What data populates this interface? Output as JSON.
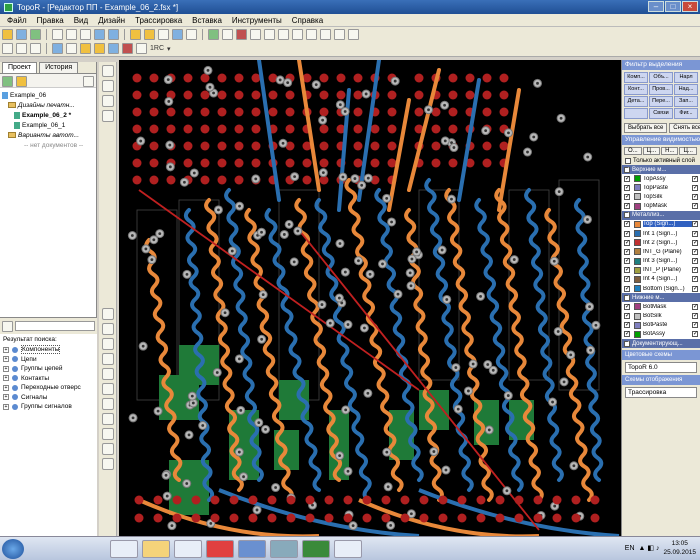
{
  "window": {
    "title": "TopoR - [Редактор ПП - Example_06_2.fsx *]"
  },
  "menu": [
    "Файл",
    "Правка",
    "Вид",
    "Дизайн",
    "Трассировка",
    "Вставка",
    "Инструменты",
    "Справка"
  ],
  "toolbar": {
    "zoom_text": "1RC"
  },
  "project": {
    "tabs": [
      "Проект",
      "История"
    ],
    "tree": [
      {
        "label": "Example_06",
        "style": "normal",
        "indent": 0,
        "icon": "doc"
      },
      {
        "label": "Дизайны печатн...",
        "style": "italic",
        "indent": 1,
        "icon": "folder"
      },
      {
        "label": "Example_06_2 *",
        "style": "bold",
        "indent": 2,
        "icon": "doc"
      },
      {
        "label": "Example_06_1",
        "style": "normal",
        "indent": 2,
        "icon": "doc"
      },
      {
        "label": "Варианты автот...",
        "style": "italic",
        "indent": 1,
        "icon": "folder"
      },
      {
        "label": "-- нет документов --",
        "style": "gray",
        "indent": 2,
        "icon": "none"
      }
    ]
  },
  "search": {
    "label": "Результат поиска:",
    "items": [
      "Компоненты",
      "Цепи",
      "Группы цепей",
      "Контакты",
      "Переходные отверс",
      "Сигналы",
      "Группы сигналов"
    ]
  },
  "right": {
    "filter_title": "Фильтр выделения",
    "filter_buttons": [
      "Комп...",
      "Объ...",
      "Нарл",
      "Конт...",
      "Пров...",
      "Над...",
      "Дета...",
      "Пере...",
      "Зап...",
      "",
      "Связи",
      "Фиг..."
    ],
    "select_all": "Выбрать все",
    "clear": "Снять все",
    "visibility_title": "Управление видимостью",
    "vis_tabs": [
      "О...",
      "Ц...",
      "Н...",
      "Ц..."
    ],
    "only_active": "Только активный слой",
    "groups": [
      {
        "name": "Верхние м...",
        "layers": [
          {
            "name": "TopAssy",
            "color": "#00a000",
            "sel": false
          },
          {
            "name": "TopPaste",
            "color": "#8080c0",
            "sel": false
          },
          {
            "name": "TopSilk",
            "color": "#c0c0c0",
            "sel": false
          },
          {
            "name": "TopMask",
            "color": "#a04080",
            "sel": false
          }
        ]
      },
      {
        "name": "Металлиз...",
        "layers": [
          {
            "name": "Top (Sign...)",
            "color": "#e8883a",
            "sel": true
          },
          {
            "name": "Int 1 (Sign...)",
            "color": "#2a6fb0",
            "sel": false
          },
          {
            "name": "Int 2 (Sign...)",
            "color": "#c03030",
            "sel": false
          },
          {
            "name": "INT_G (Plane)",
            "color": "#b08040",
            "sel": false
          },
          {
            "name": "Int 3 (Sign...)",
            "color": "#208080",
            "sel": false
          },
          {
            "name": "INT_P (Plane)",
            "color": "#a0a040",
            "sel": false
          },
          {
            "name": "Int 4 (Sign...)",
            "color": "#806040",
            "sel": false
          },
          {
            "name": "Bottom (Sign...)",
            "color": "#2080c0",
            "sel": false
          }
        ]
      },
      {
        "name": "Нижние м...",
        "layers": [
          {
            "name": "BotMask",
            "color": "#a04080",
            "sel": false
          },
          {
            "name": "BotSilk",
            "color": "#c0c0c0",
            "sel": false
          },
          {
            "name": "BotPaste",
            "color": "#8080c0",
            "sel": false
          },
          {
            "name": "BotAssy",
            "color": "#00a000",
            "sel": false
          }
        ]
      },
      {
        "name": "Документирующ...",
        "layers": []
      }
    ],
    "color_schemes_title": "Цветовые схемы",
    "color_scheme_value": "TopoR 6.0",
    "display_schemes_title": "Схемы отображения",
    "display_scheme_value": "Трассировка"
  },
  "taskbar": {
    "lang": "EN",
    "time": "13:05",
    "date": "25.09.2015"
  }
}
